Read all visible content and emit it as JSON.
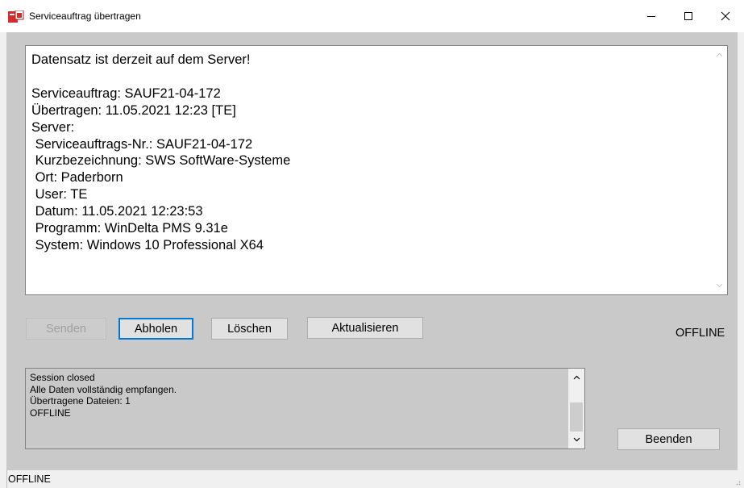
{
  "window": {
    "title": "Serviceauftrag übertragen",
    "app_icon": "winDelta-app-icon",
    "controls": {
      "minimize_icon": "minimize-icon",
      "maximize_icon": "maximize-icon",
      "close_icon": "close-icon"
    }
  },
  "main_text": {
    "content": "Datensatz ist derzeit auf dem Server!\n\nServiceauftrag: SAUF21-04-172\nÜbertragen: 11.05.2021 12:23 [TE]\nServer:\n Serviceauftrags-Nr.: SAUF21-04-172\n Kurzbezeichnung: SWS SoftWare-Systeme\n Ort: Paderborn\n User: TE\n Datum: 11.05.2021 12:23:53\n Programm: WinDelta PMS 9.31e\n System: Windows 10 Professional X64"
  },
  "buttons": {
    "senden": "Senden",
    "abholen": "Abholen",
    "loeschen": "Löschen",
    "aktualisieren": "Aktualisieren",
    "beenden": "Beenden"
  },
  "connection_status": "OFFLINE",
  "log": {
    "content": "Session closed\nAlle Daten vollständig empfangen.\nÜbertragene Dateien: 1\nOFFLINE"
  },
  "statusbar": {
    "text": "OFFLINE"
  },
  "colors": {
    "client_bg": "#c9c9c9",
    "button_bg": "#e1e1e1",
    "focus_border": "#0078d7",
    "app_icon_red": "#d42b2b"
  }
}
